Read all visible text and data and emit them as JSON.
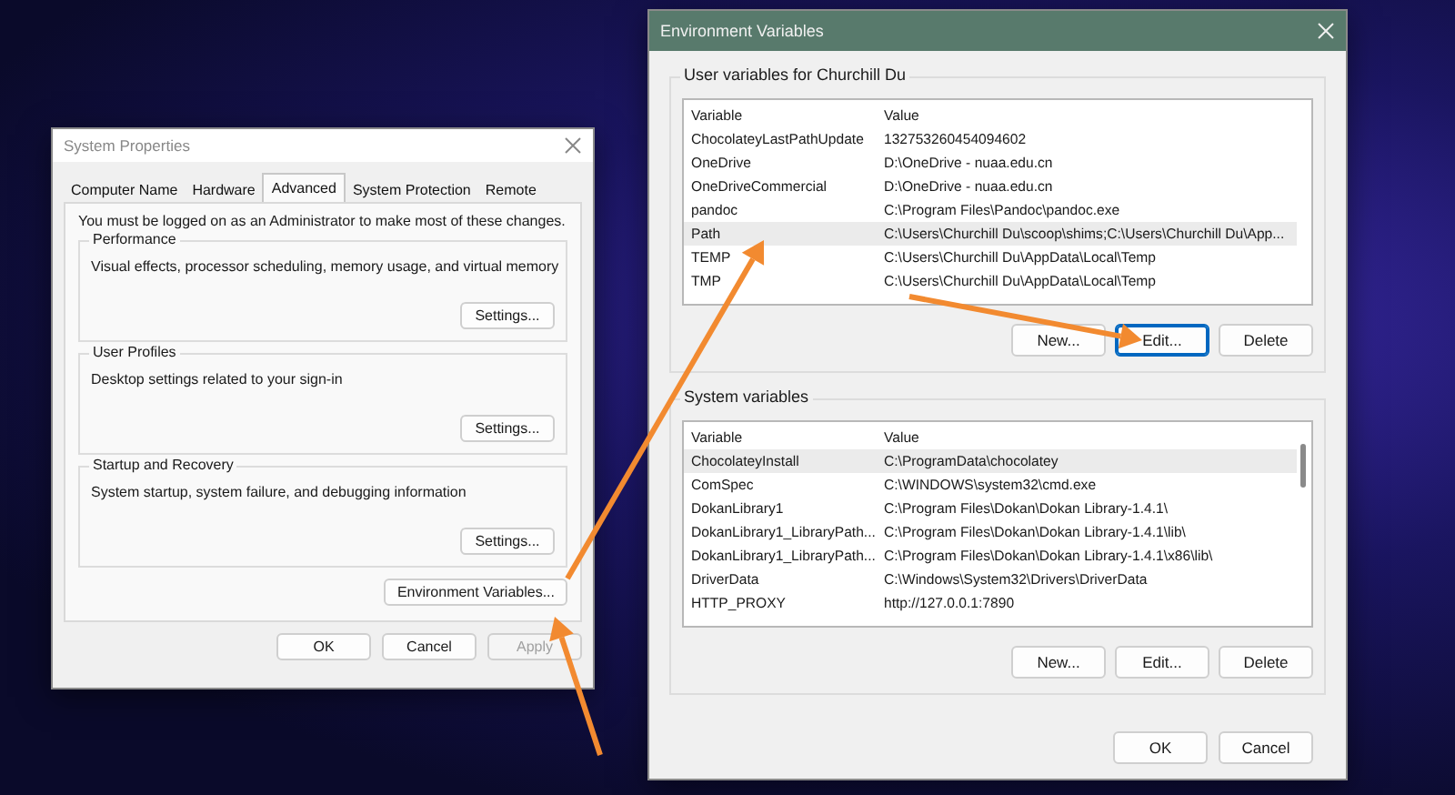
{
  "system_properties": {
    "title": "System Properties",
    "tabs": [
      {
        "label": "Computer Name",
        "selected": false
      },
      {
        "label": "Hardware",
        "selected": false
      },
      {
        "label": "Advanced",
        "selected": true
      },
      {
        "label": "System Protection",
        "selected": false
      },
      {
        "label": "Remote",
        "selected": false
      }
    ],
    "notice": "You must be logged on as an Administrator to make most of these changes.",
    "groups": [
      {
        "title": "Performance",
        "description": "Visual effects, processor scheduling, memory usage, and virtual memory",
        "button": "Settings..."
      },
      {
        "title": "User Profiles",
        "description": "Desktop settings related to your sign-in",
        "button": "Settings..."
      },
      {
        "title": "Startup and Recovery",
        "description": "System startup, system failure, and debugging information",
        "button": "Settings..."
      }
    ],
    "env_button": "Environment Variables...",
    "buttons": [
      {
        "label": "OK",
        "disabled": false
      },
      {
        "label": "Cancel",
        "disabled": false
      },
      {
        "label": "Apply",
        "disabled": true
      }
    ]
  },
  "environment_variables": {
    "title": "Environment Variables",
    "sections": [
      {
        "title": "User variables for Churchill Du",
        "columns": [
          "Variable",
          "Value"
        ],
        "rows": [
          {
            "variable": "ChocolateyLastPathUpdate",
            "value": "132753260454094602",
            "selected": false
          },
          {
            "variable": "OneDrive",
            "value": "D:\\OneDrive - nuaa.edu.cn",
            "selected": false
          },
          {
            "variable": "OneDriveCommercial",
            "value": "D:\\OneDrive - nuaa.edu.cn",
            "selected": false
          },
          {
            "variable": "pandoc",
            "value": "C:\\Program Files\\Pandoc\\pandoc.exe",
            "selected": false
          },
          {
            "variable": "Path",
            "value": "C:\\Users\\Churchill Du\\scoop\\shims;C:\\Users\\Churchill Du\\App...",
            "selected": true
          },
          {
            "variable": "TEMP",
            "value": "C:\\Users\\Churchill Du\\AppData\\Local\\Temp",
            "selected": false
          },
          {
            "variable": "TMP",
            "value": "C:\\Users\\Churchill Du\\AppData\\Local\\Temp",
            "selected": false
          }
        ],
        "buttons": [
          {
            "label": "New...",
            "focused": false
          },
          {
            "label": "Edit...",
            "focused": true
          },
          {
            "label": "Delete",
            "focused": false
          }
        ]
      },
      {
        "title": "System variables",
        "columns": [
          "Variable",
          "Value"
        ],
        "rows": [
          {
            "variable": "ChocolateyInstall",
            "value": "C:\\ProgramData\\chocolatey",
            "selected": true
          },
          {
            "variable": "ComSpec",
            "value": "C:\\WINDOWS\\system32\\cmd.exe",
            "selected": false
          },
          {
            "variable": "DokanLibrary1",
            "value": "C:\\Program Files\\Dokan\\Dokan Library-1.4.1\\",
            "selected": false
          },
          {
            "variable": "DokanLibrary1_LibraryPath...",
            "value": "C:\\Program Files\\Dokan\\Dokan Library-1.4.1\\lib\\",
            "selected": false
          },
          {
            "variable": "DokanLibrary1_LibraryPath...",
            "value": "C:\\Program Files\\Dokan\\Dokan Library-1.4.1\\x86\\lib\\",
            "selected": false
          },
          {
            "variable": "DriverData",
            "value": "C:\\Windows\\System32\\Drivers\\DriverData",
            "selected": false
          },
          {
            "variable": "HTTP_PROXY",
            "value": "http://127.0.0.1:7890",
            "selected": false
          }
        ],
        "buttons": [
          {
            "label": "New...",
            "focused": false
          },
          {
            "label": "Edit...",
            "focused": false
          },
          {
            "label": "Delete",
            "focused": false
          }
        ]
      }
    ],
    "buttons": [
      {
        "label": "OK",
        "focused": false
      },
      {
        "label": "Cancel",
        "focused": false
      }
    ]
  }
}
